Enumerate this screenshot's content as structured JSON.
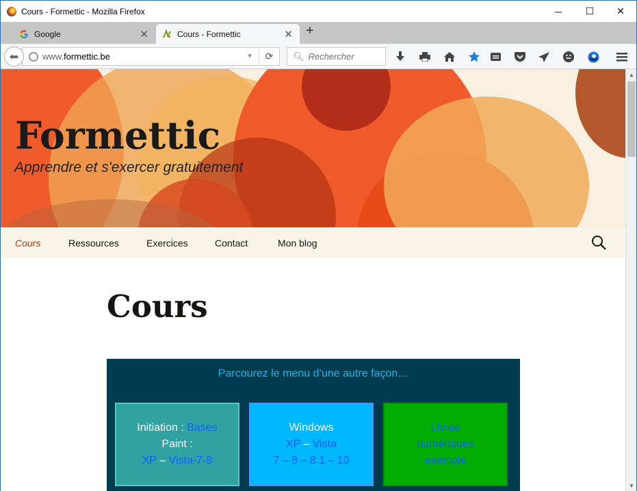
{
  "window": {
    "title": "Cours - Formettic - Mozilla Firefox",
    "minimize": "─",
    "maximize": "☐",
    "close": "✕"
  },
  "tabs": [
    {
      "title": "Google",
      "favicon": "google-icon",
      "active": false
    },
    {
      "title": "Cours - Formettic",
      "favicon": "formettic-icon",
      "active": true
    }
  ],
  "newtab_label": "+",
  "url": {
    "prefix": "www.",
    "domain": "formettic.be"
  },
  "search": {
    "placeholder": "Rechercher"
  },
  "toolbar_icons": [
    "download-icon",
    "print-icon",
    "home-icon",
    "bookmark-star-icon",
    "reading-list-icon",
    "pocket-icon",
    "send-icon",
    "emoji-icon",
    "sync-icon",
    "hamburger-menu-icon"
  ],
  "site": {
    "title": "Formettic",
    "description": "Apprendre et s'exercer gratuitement"
  },
  "nav": {
    "items": [
      "Cours",
      "Ressources",
      "Exercices",
      "Contact",
      "Mon blog"
    ],
    "current": "Cours"
  },
  "page": {
    "title": "Cours"
  },
  "panel": {
    "heading": "Parcourez le menu d’une autre façon…",
    "boxes": [
      {
        "line1_prefix": "Initiation : ",
        "line1_link": "Bases",
        "line2": "Paint :",
        "line3_a": "XP",
        "line3_sep": " – ",
        "line3_b": "Vista-7-8"
      },
      {
        "line1": "Windows",
        "line2_a": "XP",
        "line2_sep": " – ",
        "line2_b": "Vista",
        "line3": "7 – 8 – 8.1 – 10"
      },
      {
        "line1": "Livres",
        "line2": "numériques",
        "line3": "exemple"
      }
    ]
  },
  "colors": {
    "accent_star": "#1b7ed8",
    "nav_current": "#bc360a",
    "panel_bg": "#003c50",
    "panel_heading": "#0db5e9"
  }
}
